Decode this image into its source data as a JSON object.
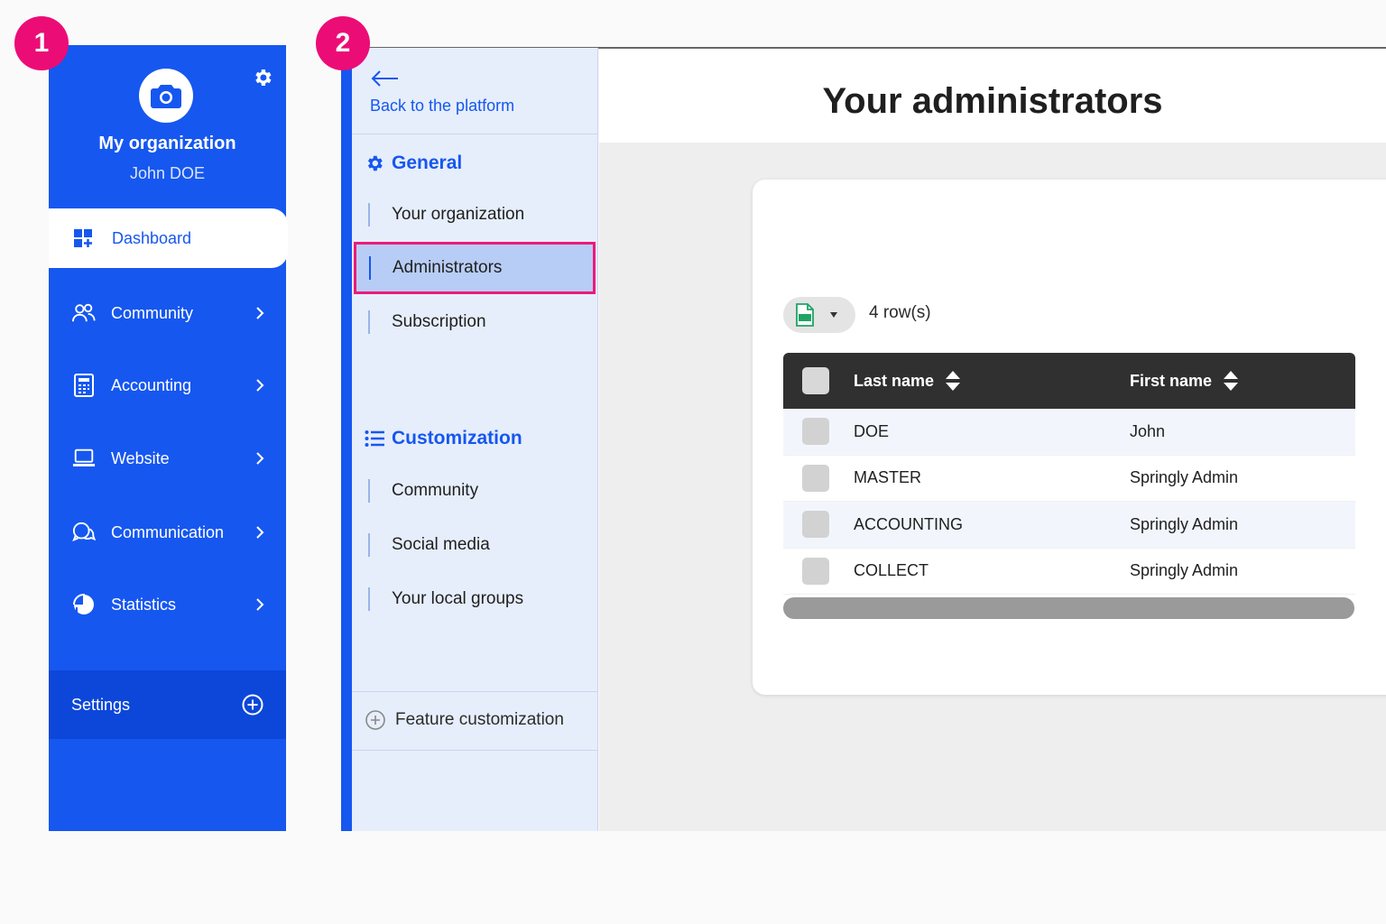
{
  "badges": {
    "one": "1",
    "two": "2"
  },
  "sidebar": {
    "org_name": "My organization",
    "user_name": "John DOE",
    "items": [
      {
        "label": "Dashboard",
        "icon": "dashboard-icon",
        "active": true
      },
      {
        "label": "Community",
        "icon": "users-icon"
      },
      {
        "label": "Accounting",
        "icon": "calculator-icon"
      },
      {
        "label": "Website",
        "icon": "laptop-icon"
      },
      {
        "label": "Communication",
        "icon": "chat-icon"
      },
      {
        "label": "Statistics",
        "icon": "pie-chart-icon"
      }
    ],
    "settings_label": "Settings"
  },
  "settings_nav": {
    "back_label": "Back to the platform",
    "general_title": "General",
    "general_items": [
      "Your organization",
      "Administrators",
      "Subscription"
    ],
    "active_item": "Administrators",
    "customization_title": "Customization",
    "customization_items": [
      "Community",
      "Social media",
      "Your local groups"
    ],
    "feature_label": "Feature customization"
  },
  "main": {
    "title": "Your administrators",
    "row_count": "4 row(s)",
    "columns": [
      "Last name",
      "First name"
    ],
    "rows": [
      [
        "DOE",
        "John"
      ],
      [
        "MASTER",
        "Springly Admin"
      ],
      [
        "ACCOUNTING",
        "Springly Admin"
      ],
      [
        "COLLECT",
        "Springly Admin"
      ]
    ]
  },
  "colors": {
    "primary": "#1657f0",
    "badge": "#ec0c76",
    "highlight_border": "#ec1a7a",
    "table_header": "#303030"
  }
}
